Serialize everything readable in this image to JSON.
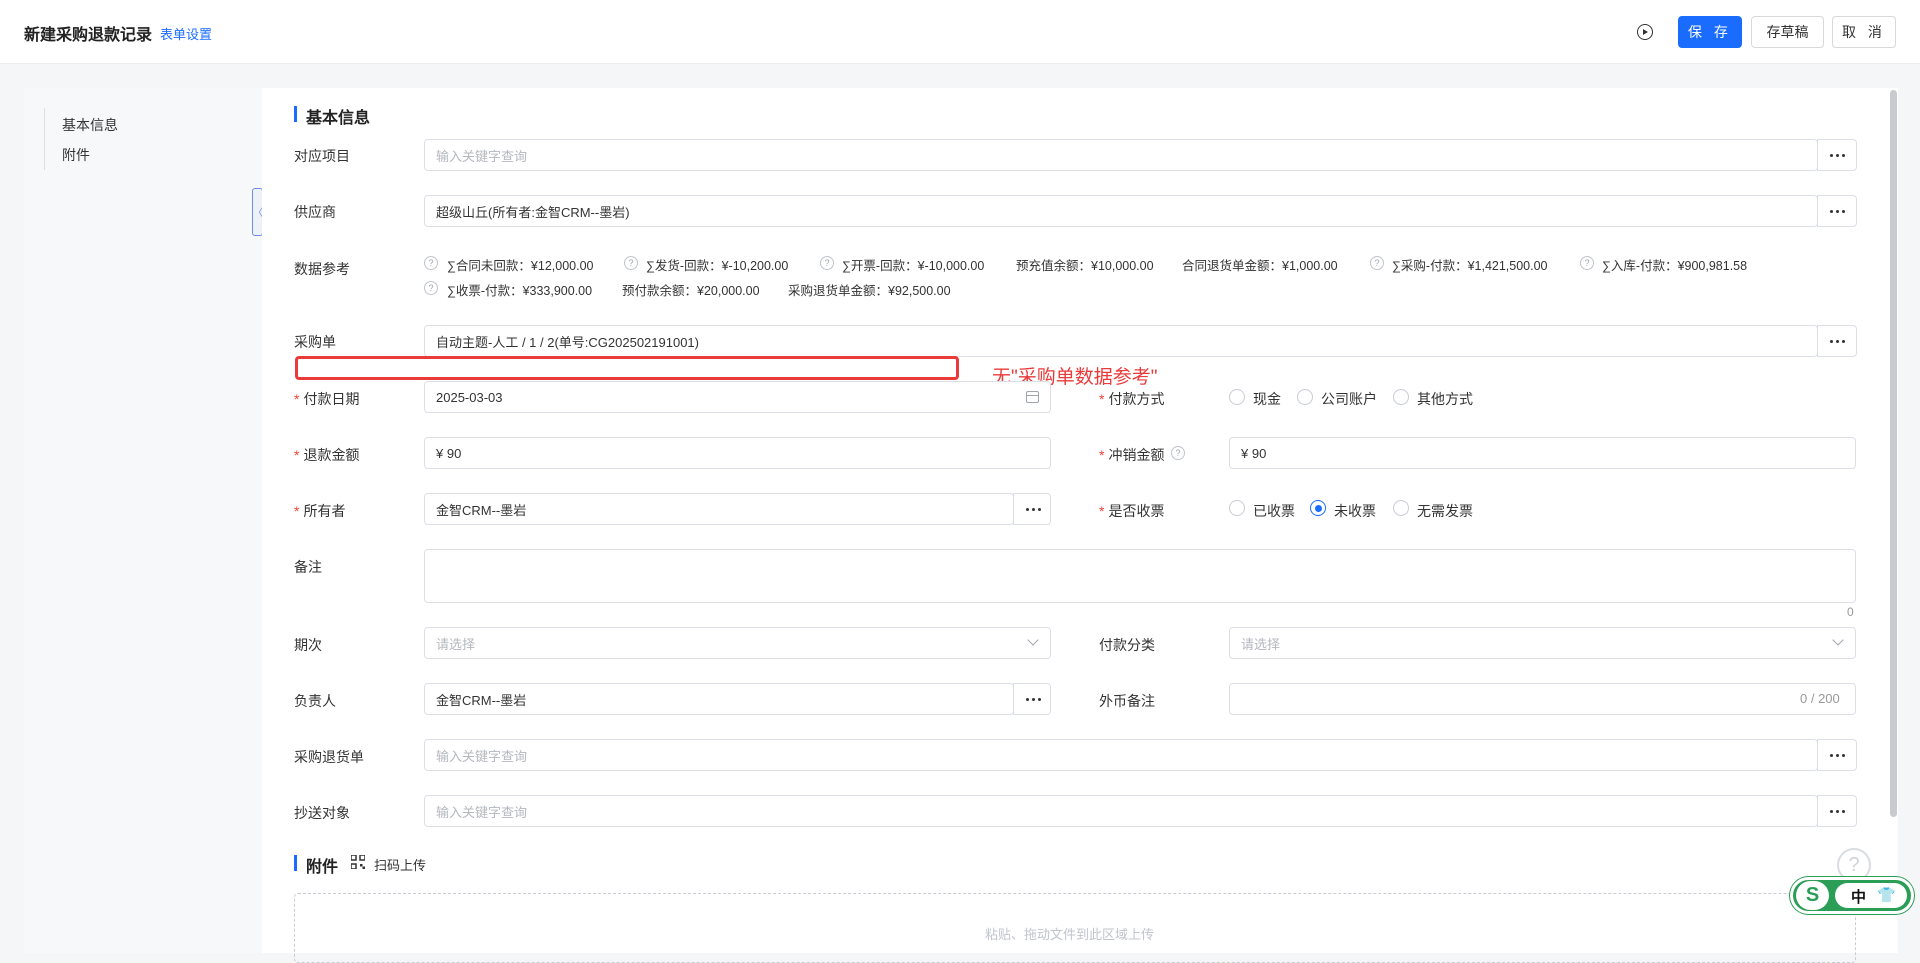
{
  "header": {
    "title": "新建采购退款记录",
    "form_settings": "表单设置",
    "save": "保 存",
    "draft": "存草稿",
    "cancel": "取 消"
  },
  "nav": {
    "items": [
      "基本信息",
      "附件"
    ]
  },
  "sections": {
    "basic": "基本信息",
    "attachment": "附件",
    "scan_upload": "扫码上传"
  },
  "fields": {
    "project": {
      "label": "对应项目",
      "placeholder": "输入关键字查询"
    },
    "supplier": {
      "label": "供应商",
      "value": "超级山丘(所有者:金智CRM--墨岩)"
    },
    "data_ref": {
      "label": "数据参考",
      "row1": [
        "∑合同未回款：¥12,000.00",
        "∑发货-回款：¥-10,200.00",
        "∑开票-回款：¥-10,000.00",
        "预充值余额：¥10,000.00",
        "合同退货单金额：¥1,000.00",
        "∑采购-付款：¥1,421,500.00",
        "∑入库-付款：¥900,981.58"
      ],
      "row2": [
        "∑收票-付款：¥333,900.00",
        "预付款余额：¥20,000.00",
        "采购退货单金额：¥92,500.00"
      ]
    },
    "purchase_order": {
      "label": "采购单",
      "value": "自动主题-人工 / 1 / 2(单号:CG202502191001)"
    },
    "pay_date": {
      "label": "付款日期",
      "value": "2025-03-03"
    },
    "pay_method": {
      "label": "付款方式",
      "options": [
        "现金",
        "公司账户",
        "其他方式"
      ]
    },
    "refund_amount": {
      "label": "退款金额",
      "value": "¥ 90"
    },
    "writeoff_amount": {
      "label": "冲销金额",
      "value": "¥ 90"
    },
    "owner": {
      "label": "所有者",
      "value": "金智CRM--墨岩"
    },
    "invoice_received": {
      "label": "是否收票",
      "options": [
        "已收票",
        "未收票",
        "无需发票"
      ],
      "selected": "未收票"
    },
    "remark": {
      "label": "备注",
      "count": "0"
    },
    "period": {
      "label": "期次",
      "placeholder": "请选择"
    },
    "pay_category": {
      "label": "付款分类",
      "placeholder": "请选择"
    },
    "manager": {
      "label": "负责人",
      "value": "金智CRM--墨岩"
    },
    "fx_remark": {
      "label": "外币备注",
      "count": "0 / 200"
    },
    "return_order": {
      "label": "采购退货单",
      "placeholder": "输入关键字查询"
    },
    "cc": {
      "label": "抄送对象",
      "placeholder": "输入关键字查询"
    }
  },
  "annotation": "无\"采购单数据参考\"",
  "upload_hint": "粘贴、拖动文件到此区域上传",
  "ime": {
    "s": "S",
    "zh": "中",
    "shirt": "👕"
  }
}
